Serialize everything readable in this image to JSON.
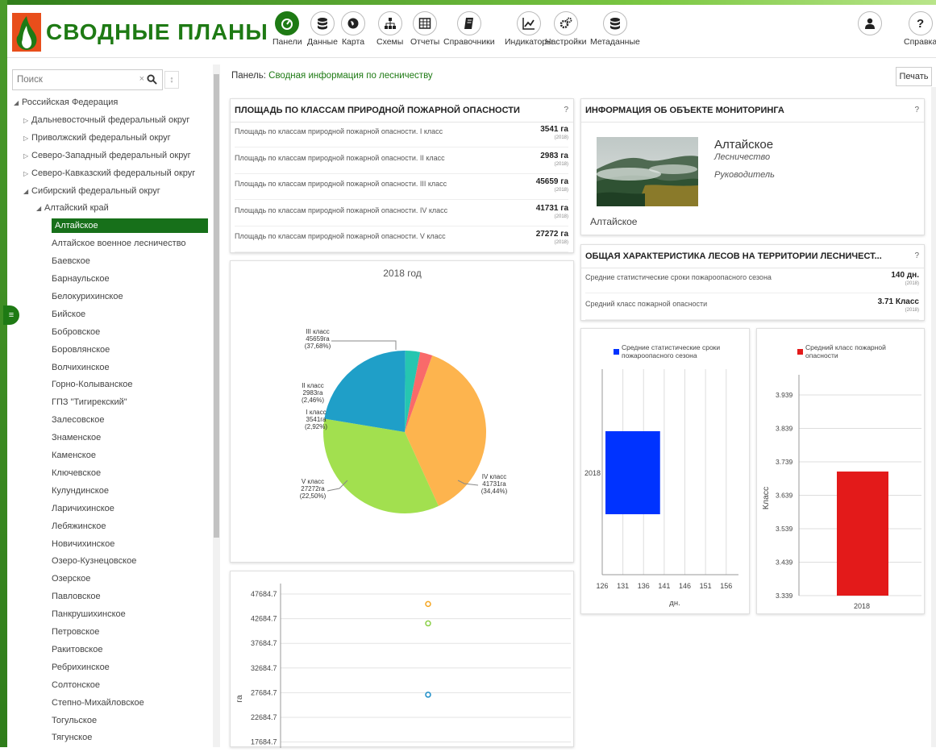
{
  "app": {
    "title": "СВОДНЫЕ ПЛАНЫ"
  },
  "nav": [
    {
      "label": "Панели",
      "icon": "dashboard-icon",
      "active": true
    },
    {
      "label": "Данные",
      "icon": "database-icon"
    },
    {
      "label": "Карта",
      "icon": "globe-icon"
    },
    {
      "label": "Схемы",
      "icon": "sitemap-icon"
    },
    {
      "label": "Отчеты",
      "icon": "table-icon"
    },
    {
      "label": "Справочники",
      "icon": "book-icon"
    },
    {
      "label": "Индикаторы",
      "icon": "line-chart-icon"
    },
    {
      "label": "Настройки",
      "icon": "gears-icon"
    },
    {
      "label": "Метаданные",
      "icon": "database-icon"
    }
  ],
  "user": {
    "label": ""
  },
  "help": {
    "label": "Справка"
  },
  "search": {
    "placeholder": "Поиск",
    "clear": "×",
    "sort": "↕"
  },
  "tree": [
    {
      "label": "Российская Федерация",
      "level": 0,
      "arrow": "◢"
    },
    {
      "label": "Дальневосточный федеральный округ",
      "level": 1,
      "arrow": "▷"
    },
    {
      "label": "Приволжский федеральный округ",
      "level": 1,
      "arrow": "▷"
    },
    {
      "label": "Северо-Западный федеральный округ",
      "level": 1,
      "arrow": "▷"
    },
    {
      "label": "Северо-Кавказский федеральный округ",
      "level": 1,
      "arrow": "▷"
    },
    {
      "label": "Сибирский федеральный округ",
      "level": 1,
      "arrow": "◢"
    },
    {
      "label": "Алтайский край",
      "level": 2,
      "arrow": "◢"
    },
    {
      "label": "Алтайское",
      "level": 3,
      "selected": true
    },
    {
      "label": "Алтайское военное лесничество",
      "level": 3
    },
    {
      "label": "Баевское",
      "level": 3
    },
    {
      "label": "Барнаульское",
      "level": 3
    },
    {
      "label": "Белокурихинское",
      "level": 3
    },
    {
      "label": "Бийское",
      "level": 3
    },
    {
      "label": "Бобровское",
      "level": 3
    },
    {
      "label": "Боровлянское",
      "level": 3
    },
    {
      "label": "Волчихинское",
      "level": 3
    },
    {
      "label": "Горно-Колыванское",
      "level": 3
    },
    {
      "label": "ГПЗ \"Тигирекский\"",
      "level": 3
    },
    {
      "label": "Залесовское",
      "level": 3
    },
    {
      "label": "Знаменское",
      "level": 3
    },
    {
      "label": "Каменское",
      "level": 3
    },
    {
      "label": "Ключевское",
      "level": 3
    },
    {
      "label": "Кулундинское",
      "level": 3
    },
    {
      "label": "Ларичихинское",
      "level": 3
    },
    {
      "label": "Лебяжинское",
      "level": 3
    },
    {
      "label": "Новичихинское",
      "level": 3
    },
    {
      "label": "Озеро-Кузнецовское",
      "level": 3
    },
    {
      "label": "Озерское",
      "level": 3
    },
    {
      "label": "Павловское",
      "level": 3
    },
    {
      "label": "Панкрушихинское",
      "level": 3
    },
    {
      "label": "Петровское",
      "level": 3
    },
    {
      "label": "Ракитовское",
      "level": 3
    },
    {
      "label": "Ребрихинское",
      "level": 3
    },
    {
      "label": "Солтонское",
      "level": 3
    },
    {
      "label": "Степно-Михайловское",
      "level": 3
    },
    {
      "label": "Тогульское",
      "level": 3
    },
    {
      "label": "Тягунское",
      "level": 3
    }
  ],
  "panel": {
    "prefix": "Панель:",
    "name": "Сводная информация по лесничеству",
    "print": "Печать"
  },
  "fire_card": {
    "title": "ПЛОЩАДЬ ПО КЛАССАМ ПРИРОДНОЙ ПОЖАРНОЙ ОПАСНОСТИ",
    "help": "?",
    "rows": [
      {
        "label": "Площадь по классам природной пожарной опасности. I класс",
        "value": "3541 га",
        "year": "(2018)"
      },
      {
        "label": "Площадь по классам природной пожарной опасности. II класс",
        "value": "2983 га",
        "year": "(2018)"
      },
      {
        "label": "Площадь по классам природной пожарной опасности. III класс",
        "value": "45659 га",
        "year": "(2018)"
      },
      {
        "label": "Площадь по классам природной пожарной опасности. IV класс",
        "value": "41731 га",
        "year": "(2018)"
      },
      {
        "label": "Площадь по классам природной пожарной опасности. V класс",
        "value": "27272 га",
        "year": "(2018)"
      }
    ]
  },
  "info_card": {
    "title": "ИНФОРМАЦИЯ ОБ ОБЪЕКТЕ МОНИТОРИНГА",
    "help": "?",
    "name": "Алтайское",
    "type": "Лесничество",
    "role": "Руководитель",
    "caption": "Алтайское"
  },
  "forest_card": {
    "title": "ОБЩАЯ ХАРАКТЕРИСТИКА ЛЕСОВ НА ТЕРРИТОРИИ ЛЕСНИЧЕСТ...",
    "help": "?",
    "rows": [
      {
        "label": "Средние статистические сроки пожароопасного сезона",
        "value": "140 дн.",
        "year": "(2018)"
      },
      {
        "label": "Средний класс пожарной опасности",
        "value": "3.71 Класс",
        "year": "(2018)"
      }
    ]
  },
  "chart_data": [
    {
      "type": "pie",
      "title": "2018 год",
      "slices": [
        {
          "name": "III класс",
          "value": 45659,
          "value_label": "45659га",
          "pct_label": "(37,68%)",
          "color": "#FDB44E"
        },
        {
          "name": "IV класс",
          "value": 41731,
          "value_label": "41731га",
          "pct_label": "(34,44%)",
          "color": "#A2E04F"
        },
        {
          "name": "V класс",
          "value": 27272,
          "value_label": "27272га",
          "pct_label": "(22,50%)",
          "color": "#1F9FC8"
        },
        {
          "name": "I класс",
          "value": 3541,
          "value_label": "3541га",
          "pct_label": "(2,92%)",
          "color": "#26C6B0"
        },
        {
          "name": "II класс",
          "value": 2983,
          "value_label": "2983га",
          "pct_label": "(2,46%)",
          "color": "#F96A6A"
        }
      ]
    },
    {
      "type": "bar",
      "orientation": "horizontal",
      "legend": "Средние статистические сроки пожароопасного сезона",
      "color": "#0033FF",
      "categories": [
        "2018"
      ],
      "values": [
        140
      ],
      "xlabel": "дн.",
      "xticks": [
        "126",
        "131",
        "136",
        "141",
        "146",
        "151",
        "156"
      ],
      "xlim": [
        126,
        158
      ]
    },
    {
      "type": "bar",
      "legend": "Средний класс пожарной опасности",
      "color": "#E31A1A",
      "categories": [
        "2018"
      ],
      "values": [
        3.71
      ],
      "ylabel": "Класс",
      "yticks": [
        "3.939",
        "3.839",
        "3.739",
        "3.639",
        "3.539",
        "3.439",
        "3.339"
      ],
      "ylim": [
        3.339,
        3.939
      ]
    },
    {
      "type": "scatter",
      "ylabel": "га",
      "yticks": [
        "47684.7",
        "42684.7",
        "37684.7",
        "32684.7",
        "27684.7",
        "22684.7",
        "17684.7"
      ],
      "points": [
        {
          "y": 45659,
          "color": "#F5A623"
        },
        {
          "y": 41731,
          "color": "#8CD04A"
        },
        {
          "y": 27272,
          "color": "#1F8FC8"
        }
      ]
    }
  ],
  "colors": {
    "brand": "#1e7a14",
    "selected": "#17701a"
  }
}
